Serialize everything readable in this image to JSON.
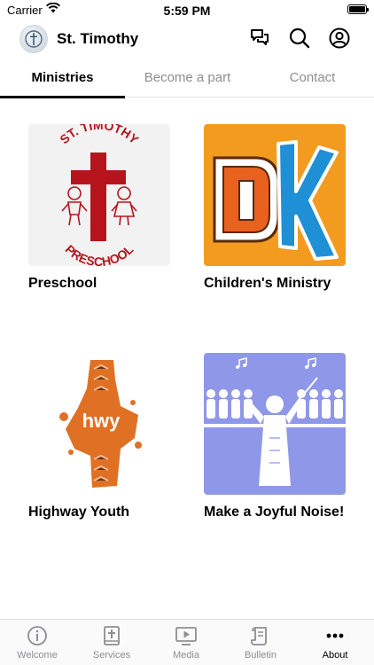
{
  "status_bar": {
    "carrier": "Carrier",
    "time": "5:59 PM"
  },
  "header": {
    "title": "St. Timothy"
  },
  "tabs": [
    {
      "label": "Ministries",
      "active": true
    },
    {
      "label": "Become a part",
      "active": false
    },
    {
      "label": "Contact",
      "active": false
    }
  ],
  "ministries": [
    {
      "label": "Preschool",
      "image_text_top": "ST. TIMOTHY",
      "image_text_bottom": "PRESCHOOL"
    },
    {
      "label": "Children's Ministry",
      "image_text": "DK"
    },
    {
      "label": "Highway Youth",
      "image_text": "hwy"
    },
    {
      "label": "Make a Joyful Noise!"
    }
  ],
  "bottom_nav": [
    {
      "label": "Welcome",
      "icon": "info-icon",
      "active": false
    },
    {
      "label": "Services",
      "icon": "bible-icon",
      "active": false
    },
    {
      "label": "Media",
      "icon": "video-icon",
      "active": false
    },
    {
      "label": "Bulletin",
      "icon": "scroll-icon",
      "active": false
    },
    {
      "label": "About",
      "icon": "more-icon",
      "active": true
    }
  ],
  "colors": {
    "preschool_red": "#b5141c",
    "dk_orange": "#f39b1f",
    "dk_blue": "#1f8fd6",
    "hwy_orange": "#e07023",
    "joyful_purple": "#8f97e8"
  }
}
